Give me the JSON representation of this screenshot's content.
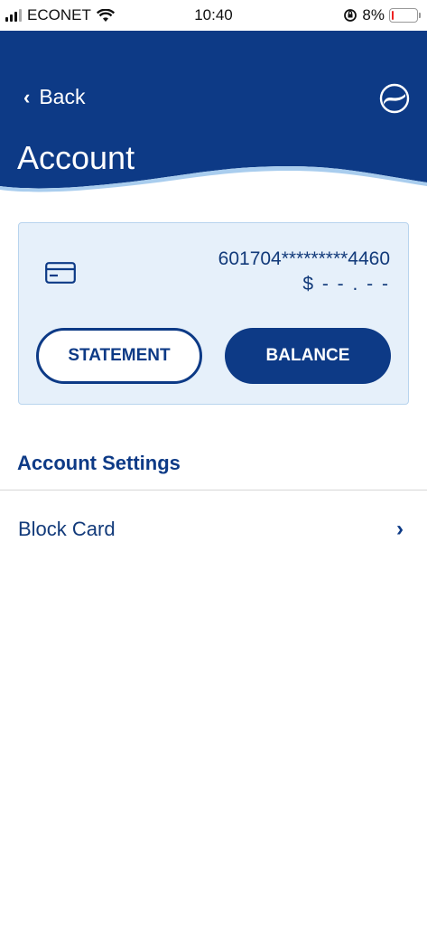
{
  "status_bar": {
    "carrier": "ECONET",
    "time": "10:40",
    "battery": "8%",
    "battery_level": 0.08
  },
  "header": {
    "back_label": "Back",
    "title": "Account"
  },
  "card": {
    "number": "601704*********4460",
    "balance": "$ - - . - -"
  },
  "actions": {
    "statement_label": "STATEMENT",
    "balance_label": "BALANCE"
  },
  "settings": {
    "title": "Account Settings",
    "items": [
      {
        "label": "Block Card"
      }
    ]
  },
  "colors": {
    "primary": "#0d3a86",
    "panel_bg": "#e6f0fa",
    "wave_light": "#a9cdee"
  },
  "icons": [
    "signal-icon",
    "wifi-icon",
    "orientation-lock-icon",
    "battery-icon",
    "back-chevron-icon",
    "brand-logo-icon",
    "card-icon",
    "chevron-right-icon"
  ]
}
